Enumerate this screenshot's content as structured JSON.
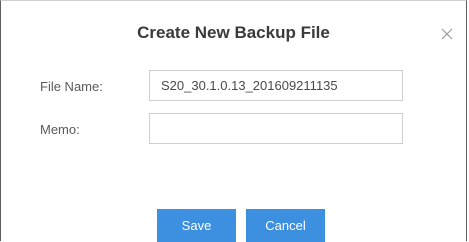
{
  "dialog": {
    "title": "Create New Backup File",
    "close_icon": "close-icon"
  },
  "form": {
    "file_name_label": "File Name:",
    "file_name_value": "S20_30.1.0.13_201609211135",
    "memo_label": "Memo:",
    "memo_value": ""
  },
  "buttons": {
    "save_label": "Save",
    "cancel_label": "Cancel",
    "accent_color": "#3d8fe0"
  }
}
